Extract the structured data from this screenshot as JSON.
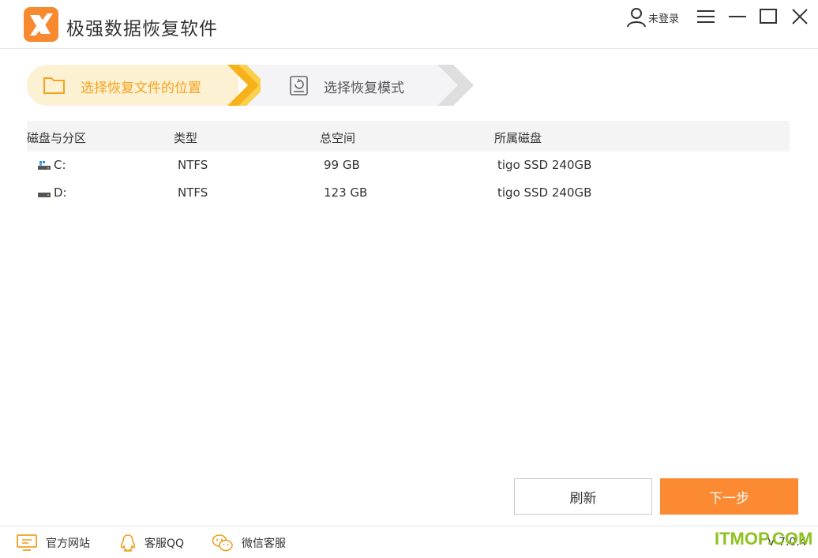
{
  "app": {
    "title": "极强数据恢复软件"
  },
  "header": {
    "user_label": "未登录"
  },
  "steps": [
    {
      "label": "选择恢复文件的位置",
      "active": true
    },
    {
      "label": "选择恢复模式",
      "active": false
    }
  ],
  "table": {
    "headers": [
      "磁盘与分区",
      "类型",
      "总空间",
      "所属磁盘"
    ],
    "rows": [
      {
        "name": "C:",
        "type": "NTFS",
        "size": "99 GB",
        "disk": "tigo SSD 240GB"
      },
      {
        "name": "D:",
        "type": "NTFS",
        "size": "123 GB",
        "disk": "tigo SSD 240GB"
      }
    ]
  },
  "buttons": {
    "refresh": "刷新",
    "next": "下一步"
  },
  "footer": {
    "website": "官方网站",
    "qq": "客服QQ",
    "wechat": "微信客服",
    "version": "V 7.0.4",
    "watermark": "ITMOP.COM"
  },
  "colors": {
    "accent": "#fb8a32",
    "step_active_bg": "#fdf1d3",
    "step_active_text": "#f7a21b",
    "watermark": "#8dc21f"
  }
}
